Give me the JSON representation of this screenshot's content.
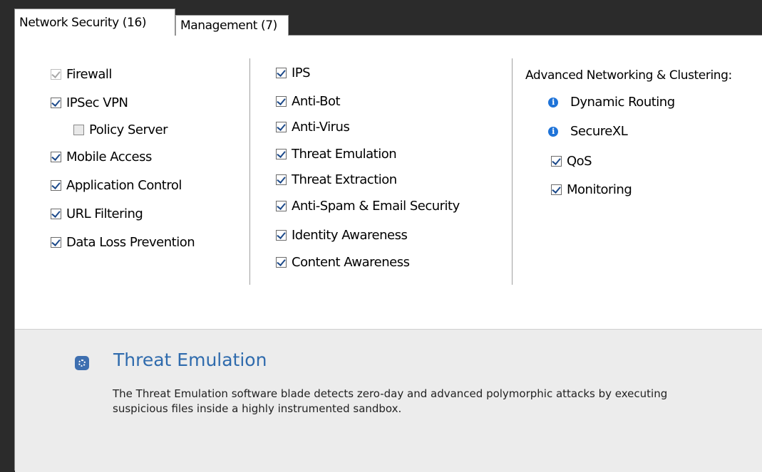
{
  "tabs": {
    "network": "Network Security (16)",
    "management": "Management (7)"
  },
  "column1": {
    "firewall": "Firewall",
    "ipsec_vpn": "IPSec VPN",
    "policy_server": "Policy Server",
    "mobile_access": "Mobile Access",
    "application_control": "Application Control",
    "url_filtering": "URL Filtering",
    "data_loss_prevention": "Data Loss Prevention"
  },
  "column2": {
    "ips": "IPS",
    "anti_bot": "Anti-Bot",
    "anti_virus": "Anti-Virus",
    "threat_emulation": "Threat Emulation",
    "threat_extraction": "Threat Extraction",
    "anti_spam": "Anti-Spam & Email Security",
    "identity_awareness": "Identity Awareness",
    "content_awareness": "Content Awareness"
  },
  "column3": {
    "heading": "Advanced Networking & Clustering:",
    "dynamic_routing": "Dynamic Routing",
    "securexl": "SecureXL",
    "qos": "QoS",
    "monitoring": "Monitoring"
  },
  "description": {
    "title": "Threat Emulation",
    "text": "The Threat Emulation software blade detects zero-day and advanced polymorphic attacks by executing suspicious files inside a highly instrumented sandbox."
  },
  "icons": {
    "info": "info-icon",
    "blade": "threat-emulation-icon"
  },
  "colors": {
    "accent": "#2f6bad",
    "info": "#1e73d8",
    "description_bg": "#ececec"
  }
}
